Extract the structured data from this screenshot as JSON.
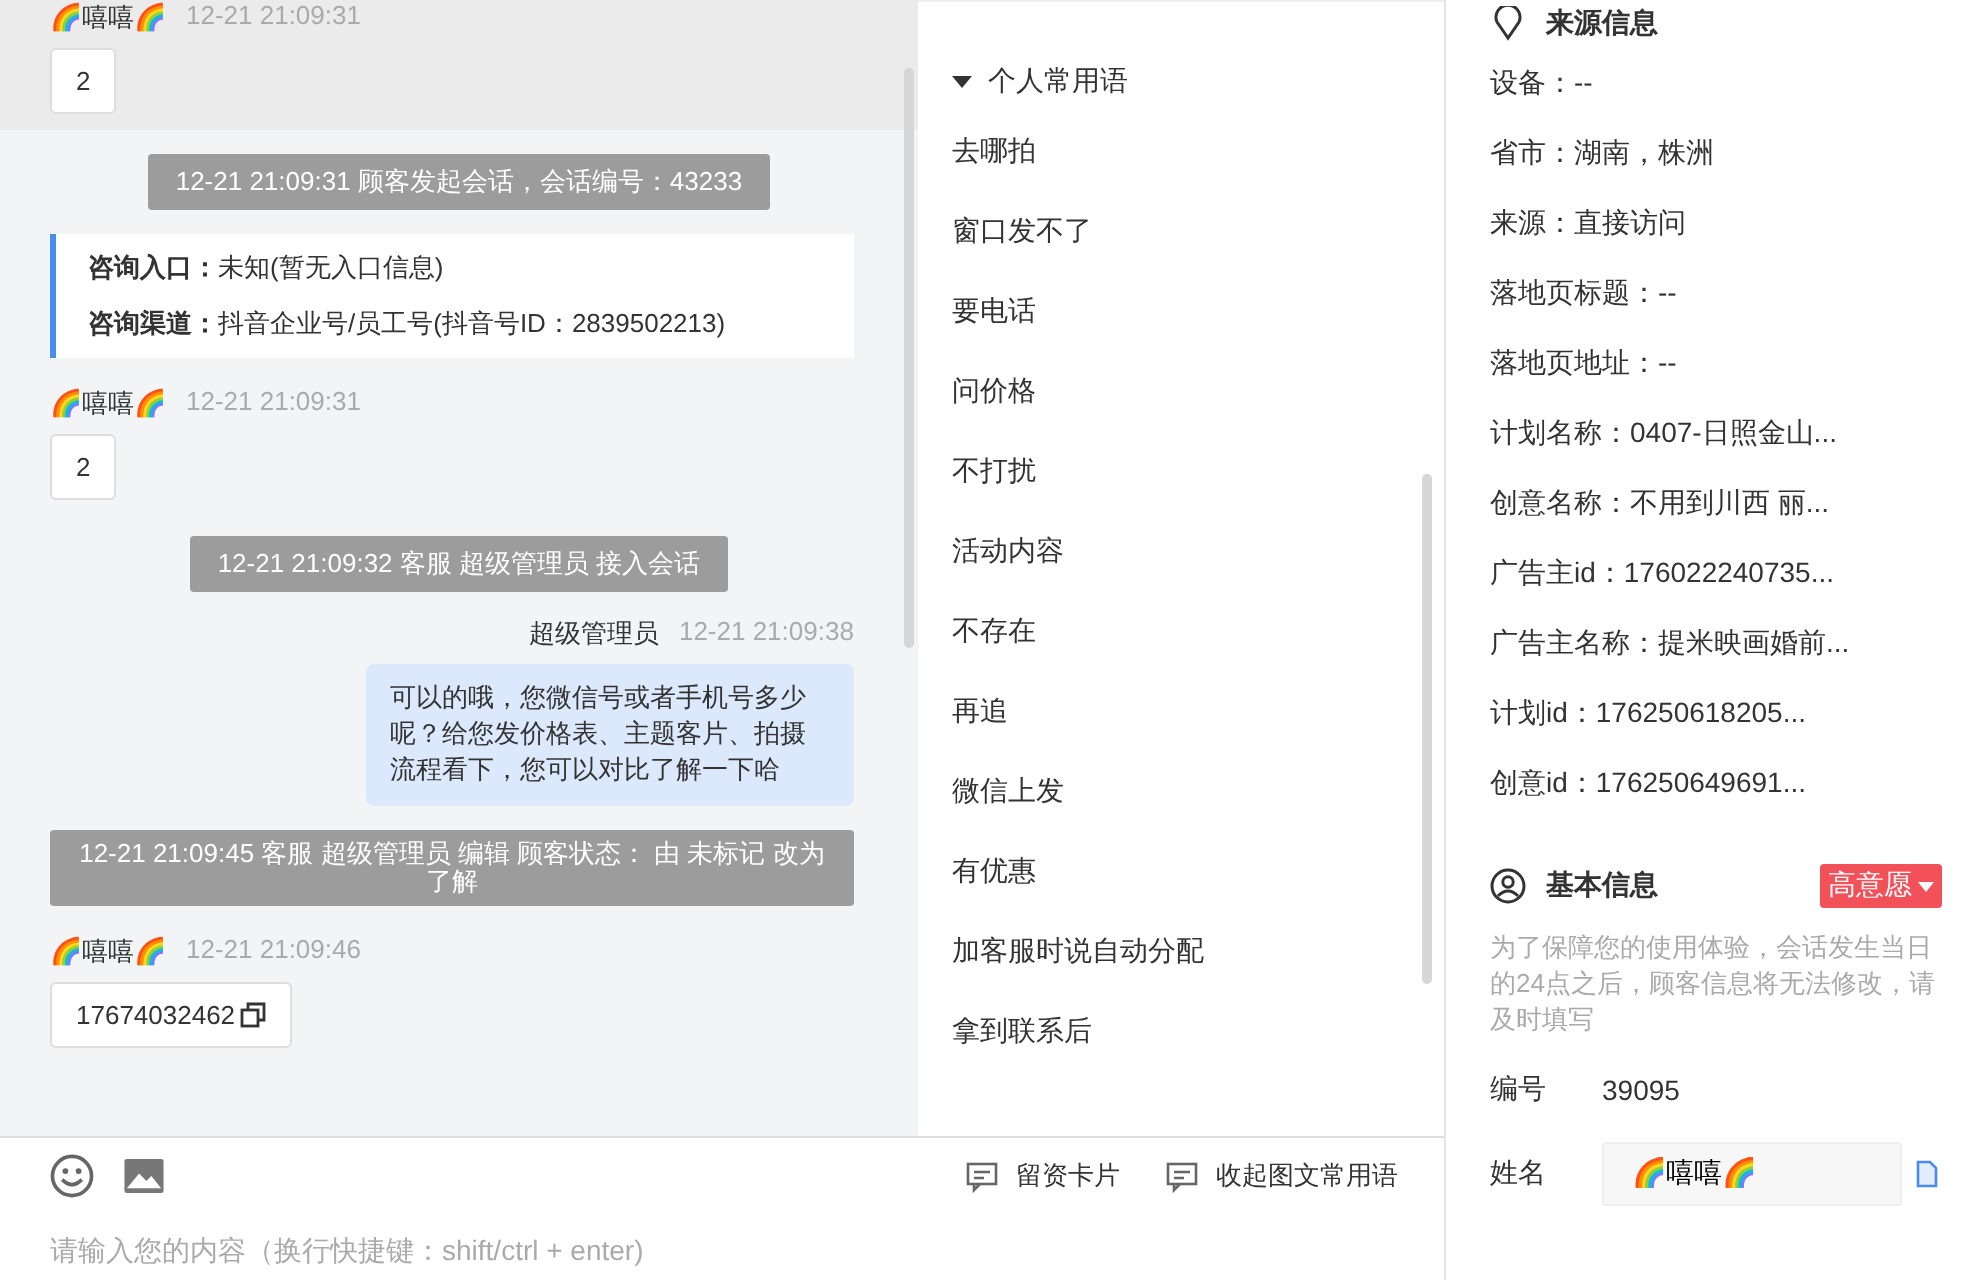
{
  "chat": {
    "messages": [
      {
        "kind": "customer",
        "sender": "🌈嘻嘻🌈",
        "time": "12-21 21:09:31",
        "text": "2",
        "highlighted": true,
        "copyable": false
      },
      {
        "kind": "system",
        "text": "12-21 21:09:31 顾客发起会话，会话编号：43233"
      },
      {
        "kind": "info",
        "rows": [
          {
            "label": "咨询入口：",
            "value": "未知(暂无入口信息)"
          },
          {
            "label": "咨询渠道：",
            "value": "抖音企业号/员工号(抖音号ID：2839502213)"
          }
        ]
      },
      {
        "kind": "customer",
        "sender": "🌈嘻嘻🌈",
        "time": "12-21 21:09:31",
        "text": "2",
        "highlighted": false,
        "copyable": false
      },
      {
        "kind": "system",
        "text": "12-21 21:09:32 客服 超级管理员 接入会话"
      },
      {
        "kind": "agent",
        "sender": "超级管理员",
        "time": "12-21 21:09:38",
        "text": "可以的哦，您微信号或者手机号多少呢？给您发价格表、主题客片、拍摄流程看下，您可以对比了解一下哈"
      },
      {
        "kind": "system",
        "text": "12-21 21:09:45 客服 超级管理员 编辑 顾客状态： 由 未标记 改为了解"
      },
      {
        "kind": "customer",
        "sender": "🌈嘻嘻🌈",
        "time": "12-21 21:09:46",
        "text": "17674032462",
        "highlighted": false,
        "copyable": true
      }
    ]
  },
  "phrases": {
    "group": "个人常用语",
    "expanded": true,
    "items": [
      "去哪拍",
      "窗口发不了",
      "要电话",
      "问价格",
      "不打扰",
      "活动内容",
      "不存在",
      "再追",
      "微信上发",
      "有优惠",
      "加客服时说自动分配",
      "拿到联系后"
    ]
  },
  "composer": {
    "actions": [
      "留资卡片",
      "收起图文常用语"
    ],
    "placeholder": "请输入您的内容（换行快捷键：shift/ctrl + enter)"
  },
  "source_info": {
    "title": "来源信息",
    "rows": [
      "设备：--",
      "省市：湖南，株洲",
      "来源：直接访问",
      "落地页标题：--",
      "落地页地址：--",
      "计划名称：0407-日照金山...",
      "创意名称：不用到川西 丽...",
      "广告主id：176022240735...",
      "广告主名称：提米映画婚前...",
      "计划id：176250618205...",
      "创意id：176250649691..."
    ]
  },
  "basic_info": {
    "title": "基本信息",
    "intent": "高意愿",
    "notice": "为了保障您的使用体验，会话发生当日的24点之后，顾客信息将无法修改，请及时填写",
    "fields": [
      {
        "kind": "text",
        "label": "编号",
        "value": "39095"
      },
      {
        "kind": "input",
        "label": "姓名",
        "value": "🌈嘻嘻🌈"
      }
    ]
  }
}
